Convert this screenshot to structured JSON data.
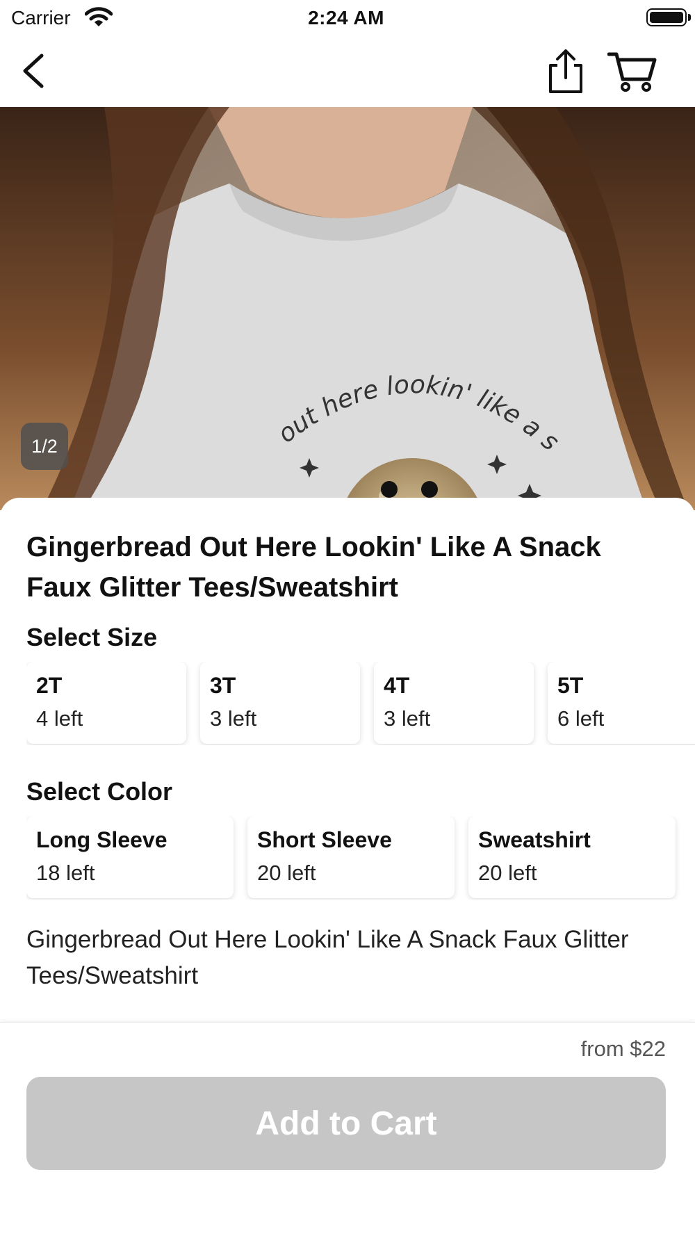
{
  "status_bar": {
    "carrier": "Carrier",
    "time": "2:24 AM",
    "icons": [
      "wifi-icon",
      "battery-icon"
    ]
  },
  "nav": {
    "icons": [
      "back-chevron-icon",
      "share-icon",
      "cart-icon"
    ]
  },
  "hero": {
    "page_indicator": "1/2",
    "shirt_print_text": "out here lookin' like a snack"
  },
  "product": {
    "title": "Gingerbread Out Here Lookin' Like A Snack Faux Glitter Tees/Sweatshirt",
    "description": "Gingerbread Out Here Lookin' Like A Snack Faux Glitter Tees/Sweatshirt"
  },
  "size_section": {
    "label": "Select Size",
    "options": [
      {
        "name": "2T",
        "stock": "4 left"
      },
      {
        "name": "3T",
        "stock": "3 left"
      },
      {
        "name": "4T",
        "stock": "3 left"
      },
      {
        "name": "5T",
        "stock": "6 left"
      }
    ]
  },
  "color_section": {
    "label": "Select Color",
    "options": [
      {
        "name": "Long Sleeve",
        "stock": "18 left"
      },
      {
        "name": "Short Sleeve",
        "stock": "20 left"
      },
      {
        "name": "Sweatshirt",
        "stock": "20 left"
      }
    ]
  },
  "footer": {
    "price": "from $22",
    "add_to_cart_label": "Add to Cart",
    "add_to_cart_color": "#c6c6c6"
  }
}
